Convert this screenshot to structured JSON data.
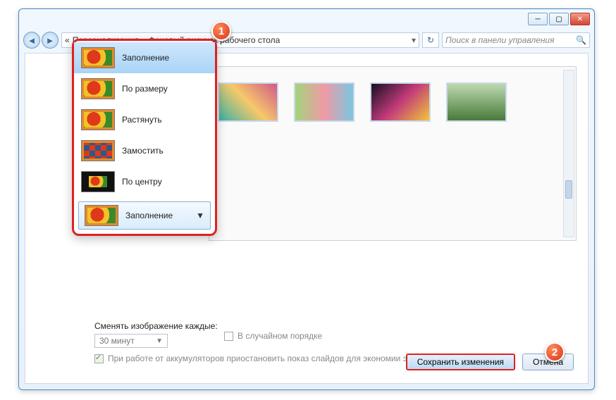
{
  "window": {
    "breadcrumb": {
      "level1": "Персонализация",
      "level2": "Фоновый рисунок рабочего стола"
    },
    "search_placeholder": "Поиск в панели управления"
  },
  "fit_menu": {
    "items": [
      {
        "label": "Заполнение",
        "selected": true
      },
      {
        "label": "По размеру",
        "selected": false
      },
      {
        "label": "Растянуть",
        "selected": false
      },
      {
        "label": "Замостить",
        "selected": false
      },
      {
        "label": "По центру",
        "selected": false
      }
    ],
    "current": "Заполнение"
  },
  "slideshow": {
    "change_label": "Сменять изображение каждые:",
    "interval": "30 минут",
    "random_label": "В случайном порядке",
    "battery_label": "При работе от аккумуляторов приостановить показ слайдов для экономии электроэнергии"
  },
  "buttons": {
    "save": "Сохранить изменения",
    "cancel": "Отмена"
  },
  "markers": {
    "m1": "1",
    "m2": "2"
  }
}
